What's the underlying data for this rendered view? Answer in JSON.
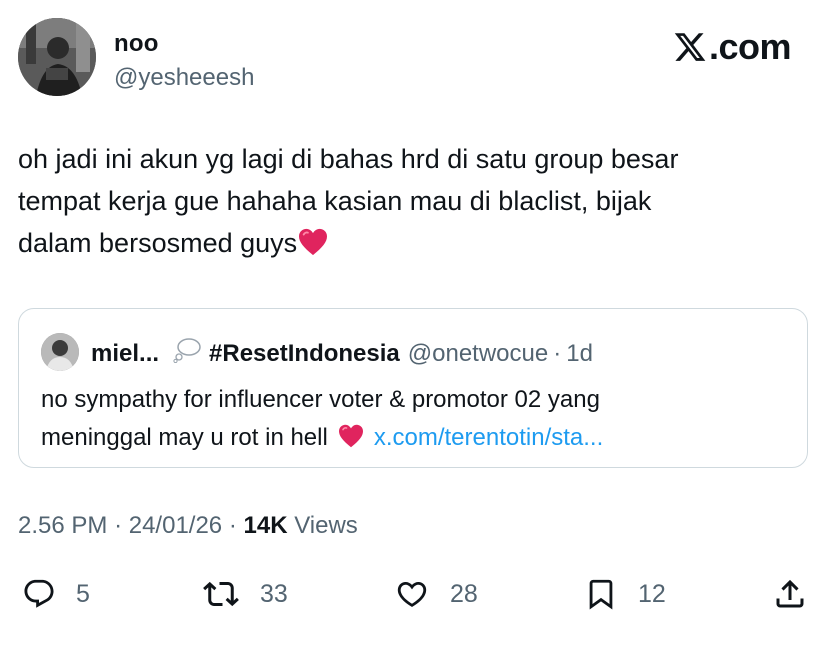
{
  "author": {
    "name": "noo",
    "handle": "@yesheeesh",
    "avatar_icon": "profile-photo"
  },
  "brand": {
    "logo_icon": "x-logo-icon",
    "logo_text": ".com"
  },
  "tweet": {
    "line1": "oh jadi ini akun yg lagi di bahas hrd di satu group besar",
    "line2": "tempat kerja gue hahaha kasian mau di blaclist, bijak",
    "line3": "dalam bersosmed guys",
    "emoji": "heart-emoji"
  },
  "quote": {
    "name": "miel...",
    "bubble_icon": "thought-bubble-icon",
    "tag": "#ResetIndonesia",
    "handle": "@onetwocue",
    "separator": "·",
    "age": "1d",
    "line1": "no sympathy for influencer voter & promotor 02 yang",
    "line2": "meninggal may u rot in hell",
    "link": "x.com/terentotin/sta..."
  },
  "meta": {
    "time": "2.56 PM",
    "sep1": "·",
    "date": "24/01/26",
    "sep2": "·",
    "views_count": "14K",
    "views_label": "Views"
  },
  "actions": {
    "replies": "5",
    "reposts": "33",
    "likes": "28",
    "bookmarks": "12"
  },
  "colors": {
    "text": "#0f1419",
    "secondary": "#536471",
    "link": "#1d9bf0",
    "border": "#cfd9de",
    "heart": "#e0245e"
  }
}
